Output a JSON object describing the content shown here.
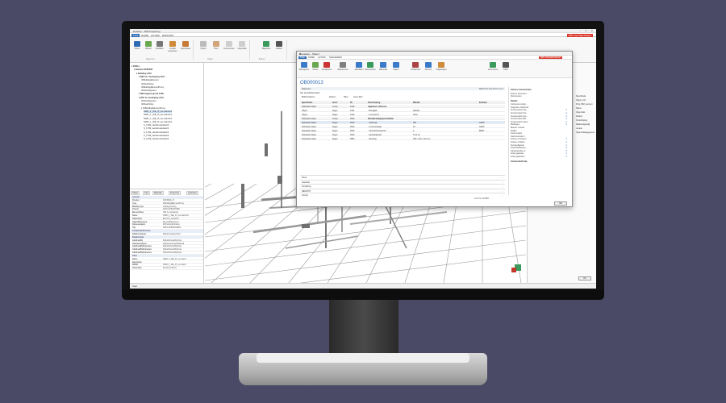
{
  "main": {
    "title": "Relatics – BIM Koppeling",
    "window_controls": "–  ▢  ✕",
    "menu": [
      "FILE",
      "HOME",
      "ACTIES",
      "RAPPORT"
    ],
    "badge": "NPL Centrale beheer",
    "ribbon": [
      {
        "label": "Home",
        "color": "#2d6bb5"
      },
      {
        "label": "Wissen",
        "color": "#6aa84f"
      },
      {
        "label": "Modellen",
        "color": "#777777"
      },
      {
        "label": "Locatie selecteren",
        "color": "#d08b3c"
      },
      {
        "label": "Specificatie",
        "color": "#c67a35"
      },
      {
        "label": "Object",
        "color": "#bcbcbc"
      },
      {
        "label": "Bron",
        "color": "#d4a47a"
      },
      {
        "label": "Documenten",
        "color": "#cfcfcf"
      },
      {
        "label": "Oppervlak",
        "color": "#cfcfcf"
      },
      {
        "label": "Bijwerken",
        "color": "#3a9a5c"
      },
      {
        "label": "Zoeken",
        "color": "#555555"
      }
    ],
    "ribbon_groups": [
      "Algemeen",
      "Object",
      "Beheer"
    ],
    "status": "Klaar",
    "ok": "OK"
  },
  "tree": [
    {
      "text": "▾ FM4LL",
      "level": 0,
      "bold": true
    },
    {
      "text": "▾ Default #2265028",
      "level": 1,
      "bold": true
    },
    {
      "text": "▾ Building #110",
      "level": 2,
      "bold": true
    },
    {
      "text": "▾ NW b.b. Verdieping #127",
      "level": 3,
      "bold": true
    },
    {
      "text": "IfcBuildingElement",
      "level": 4
    },
    {
      "text": "IfcFlowFitting",
      "level": 4
    },
    {
      "text": "IfcBuildingElementProxy",
      "level": 4
    },
    {
      "text": "IfcFlowSegment",
      "level": 4
    },
    {
      "text": "▾ NW begane grond #129",
      "level": 3,
      "bold": true
    },
    {
      "text": "▾ WVI 1e verdieping #131",
      "level": 3,
      "bold": true
    },
    {
      "text": "IfcFlowSegment",
      "level": 4
    },
    {
      "text": "IfcFlowFitting",
      "level": 4
    },
    {
      "text": "▾ IfcBuildingElementProxy",
      "level": 4
    },
    {
      "text": "NWR_1 _WE_IX_ver-stand/mt",
      "level": 5
    },
    {
      "text": "NWR_1 _WE_IX_ver-stand/mt",
      "level": 5
    },
    {
      "text": "NWR_1 _WE_IX_ver-stand/mt",
      "level": 5
    },
    {
      "text": "NWR_1 _WE_IX_ver-stand/mt",
      "level": 5
    },
    {
      "text": "S_1T99_stand/meterkast/3",
      "level": 5
    },
    {
      "text": "S_1T99_stand/meterkast/3",
      "level": 5
    },
    {
      "text": "S_1T99_stand/meterkast/3",
      "level": 5
    },
    {
      "text": "S_1T99_stand/meterkast/3",
      "level": 5
    },
    {
      "text": "S_1T99_stand/meterkast/3",
      "level": 5
    }
  ],
  "props": {
    "tabs": [
      "Object",
      "Type",
      "Materials",
      "Properties",
      "Quantities"
    ],
    "sections": [
      {
        "title": "General",
        "rows": [
          [
            "IfcLabel",
            "ROOMSG_H"
          ],
          [
            "Type",
            "IfcBuildingElementProxy"
          ],
          [
            "Building Type",
            "Heating/cooling"
          ],
          [
            "IfcGuid",
            "1BOm1P8d0Fh4B6"
          ],
          [
            "ElementStory",
            "NW 1e verdieping"
          ],
          [
            "Name",
            "NWR_1_WE_IX_ver-stand/mt"
          ],
          [
            "ObjectType",
            "Element_standard"
          ],
          [
            "ObjectPlacement",
            "IfcLocalPlacement"
          ],
          [
            "Representation",
            "IfcProductDefinition"
          ],
          [
            "Tag",
            "1BOm1P8d0Fh4B6d"
          ]
        ]
      },
      {
        "title": "ContainedInStructure",
        "rows": [
          [
            "IfcRelContained",
            "IfcRelContained #12"
          ]
        ]
      },
      {
        "title": "Relationships",
        "rows": [
          [
            "IsDefinedBy",
            "IfcRelDefinesByProps"
          ],
          [
            "HasAssociations",
            "IfcRelAssociatesMaterial"
          ],
          [
            "IsDefinedByProperties",
            "IfcRelDefinesByProps"
          ],
          [
            "IsDefinedByProperties",
            "IfcRelDefinesByProps"
          ],
          [
            "IsDefinedByProperties",
            "IfcRelDefinesByProps"
          ]
        ]
      },
      {
        "title": "Other",
        "rows": [
          [
            "Name",
            "NWR_1_WE_IX_ver-stand"
          ],
          [
            "Description",
            ""
          ],
          [
            "FBSID",
            "NWR_1_WE_IX_ver-stand"
          ],
          [
            "Ownership",
            "IfcOwnerHistory"
          ]
        ]
      }
    ]
  },
  "rpanel": {
    "lines": [
      "Specificatie",
      "Object_info",
      "Prop_BIM_element",
      "Status",
      "Oppervlak",
      "Default",
      "Omschrijving",
      "Maatschappelijk",
      "Locatie",
      "Oppervlaktegegevens"
    ]
  },
  "dialog": {
    "title": "Bewerken - Object",
    "tabs": [
      "FILE",
      "HOME",
      "ACTIES",
      "NAVIGEREN"
    ],
    "badge": "NPL Centrale beheer",
    "ribbon": [
      {
        "label": "Weergeven",
        "color": "#3a7ac8"
      },
      {
        "label": "Nieuw",
        "color": "#6aa84f"
      },
      {
        "label": "Verwijderen",
        "color": "#cc3333"
      },
      {
        "label": "Objectinvoer",
        "color": "#7f7f7f"
      },
      {
        "label": "Afdrukken",
        "color": "#3a7ac8"
      },
      {
        "label": "Documenten",
        "color": "#3a9a5c"
      },
      {
        "label": "Materiaal",
        "color": "#3a7ac8"
      },
      {
        "label": "Object",
        "color": "#3a7ac8"
      },
      {
        "label": "Onderhoud",
        "color": "#a44"
      },
      {
        "label": "Normen",
        "color": "#3a7ac8"
      },
      {
        "label": "Koppelingen",
        "color": "#d08b3c"
      },
      {
        "label": "Vernieuwen",
        "color": "#3a9a5c"
      },
      {
        "label": "Filter",
        "color": "#555555"
      }
    ],
    "code": "OB000013",
    "general_label": "Algemeen",
    "general_right": "BRR1008   16/1/2019   CLGS",
    "spec_label": "Alle specificatievelden",
    "toolbar": [
      "BOM Kopiëren",
      "Zoeken",
      "Filter",
      "Geen filter"
    ],
    "columns": [
      "Specificatie",
      "Soort",
      "Nr.",
      "Omschrijving",
      "Waarde",
      "Eenheid"
    ],
    "rows": [
      {
        "cells": [
          "Standaard object",
          "Groep",
          "2100",
          "Algemeen / diversen",
          "",
          ""
        ],
        "style": "g"
      },
      {
        "cells": [
          "Object",
          "Regel",
          "2110",
          "- Bouwjaar",
          "Waarde",
          ""
        ],
        "style": ""
      },
      {
        "cells": [
          "Object",
          "Regel",
          "2120",
          "- Leverancier",
          "Tekst",
          ""
        ],
        "style": ""
      },
      {
        "cells": [
          "Standaard object",
          "Groep",
          "2500",
          "Brandbeveiligingsinstallatie",
          "",
          ""
        ],
        "style": "g"
      },
      {
        "cells": [
          "Standaard object",
          "Regel",
          "2510",
          "- nationaal",
          "200",
          "GDNT"
        ],
        "style": "sel"
      },
      {
        "cells": [
          "Standaard object",
          "Regel",
          "2520",
          "- constructiejaar",
          "24",
          "GDNT"
        ],
        "style": ""
      },
      {
        "cells": [
          "Standaard object",
          "Regel",
          "2530",
          "- inhoud/ontwerpdruk",
          "2",
          "BRNT"
        ],
        "style": ""
      },
      {
        "cells": [
          "Standaard object",
          "Regel",
          "2540",
          "- aansluitgebied",
          "6 1/2 dn",
          ""
        ],
        "style": ""
      },
      {
        "cells": [
          "Standaard object",
          "Regel",
          "2550",
          "- afmeting",
          "180 x 210 x 115 mm",
          ""
        ],
        "style": ""
      }
    ],
    "fasttabs": [
      "Rond",
      "Garantie",
      "Verwijzing",
      "NEN2767",
      "Overig"
    ],
    "footer_right": "FA.0TE   GDNBR",
    "factbox_title1": "Externe documenten",
    "factbox_lines1": [
      "Externe document...",
      "Documenten"
    ],
    "factbox_title2": "Details",
    "factbox_items": [
      [
        "Component volgn...",
        ""
      ],
      [
        "Volgende onderhoud",
        ""
      ],
      [
        "Serviceorders (Op...",
        "0"
      ],
      [
        "Serviceorders (Cu...",
        "0"
      ],
      [
        "Serviceorders (Ge...",
        "0"
      ],
      [
        "Serviceorders (Be...",
        "0"
      ],
      [
        "Serviceorders teken...",
        "0"
      ],
      [
        "Meldingen",
        "0"
      ],
      [
        "Bouwer contract",
        ""
      ],
      [
        "Relatie",
        ""
      ],
      [
        "Factuurnaam",
        ""
      ],
      [
        "Factuurcontact 1",
        ""
      ],
      [
        "Actieve contracten",
        "0"
      ],
      [
        "Actieve contacts",
        "0"
      ],
      [
        "Serviceobjecten",
        "0"
      ],
      [
        "Inspectieobjecten",
        "0"
      ],
      [
        "Garantieacties (v...",
        "0"
      ],
      [
        "Acties garantie...",
        "0"
      ],
      [
        "Acties garanties...",
        "0"
      ]
    ],
    "factbox_title3": "Verhuurmethode",
    "ok": "OK"
  }
}
